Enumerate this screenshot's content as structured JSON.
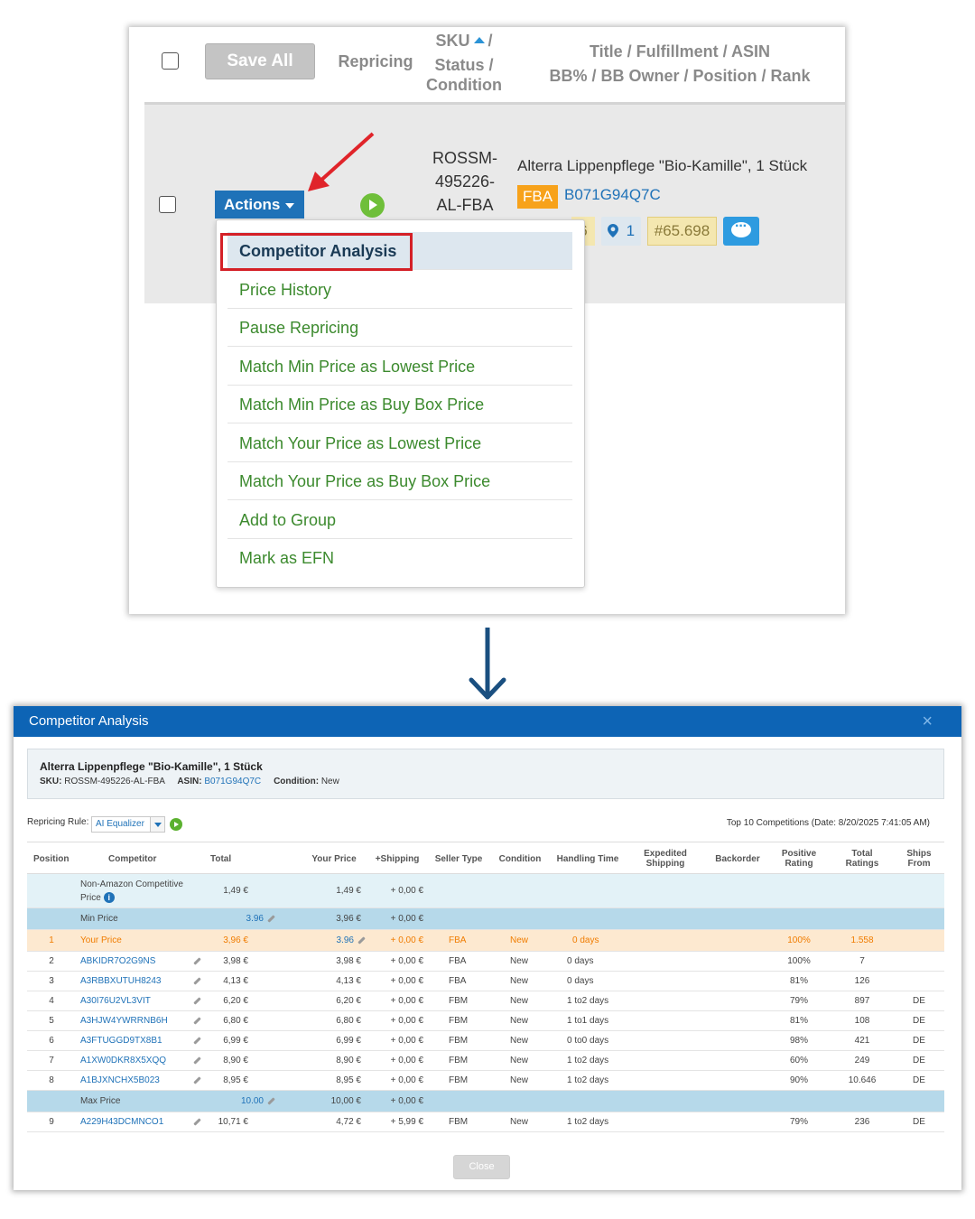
{
  "top_panel": {
    "header": {
      "save_all": "Save All",
      "repricing": "Repricing",
      "sku_line1": "SKU",
      "sku_slash": "/",
      "sku_line2": "Status /",
      "sku_line3": "Condition",
      "title_line1": "Title / Fulfillment / ASIN",
      "title_line2": "BB% / BB Owner / Position / Rank"
    },
    "row": {
      "actions_label": "Actions",
      "sku_lines": [
        "ROSSM-",
        "495226-",
        "AL-FBA"
      ],
      "title": "Alterra Lippenpflege \"Bio-Kamille\", 1 Stück",
      "fulfillment": "FBA",
      "asin": "B071G94Q7C",
      "bb_partial": "6",
      "position": "1",
      "rank": "#65.698"
    },
    "menu": {
      "items": [
        "Competitor Analysis",
        "Price History",
        "Pause Repricing",
        "Match Min Price as Lowest Price",
        "Match Min Price as Buy Box Price",
        "Match Your Price as Lowest Price",
        "Match Your Price as Buy Box Price",
        "Add to Group",
        "Mark as EFN"
      ]
    }
  },
  "modal": {
    "title": "Competitor Analysis",
    "close_x": "×",
    "product": {
      "title": "Alterra Lippenpflege \"Bio-Kamille\", 1 Stück",
      "sku_label": "SKU:",
      "sku": "ROSSM-495226-AL-FBA",
      "asin_label": "ASIN:",
      "asin": "B071G94Q7C",
      "condition_label": "Condition:",
      "condition": "New"
    },
    "repricing_rule_label": "Repricing Rule:",
    "repricing_rule_value": "AI Equalizer",
    "top_competitions": "Top 10 Competitions (Date: 8/20/2025 7:41:05 AM)",
    "columns": [
      "Position",
      "Competitor",
      "Total",
      "Your Price",
      "+Shipping",
      "Seller Type",
      "Condition",
      "Handling Time",
      "Expedited Shipping",
      "Backorder",
      "Positive Rating",
      "Total Ratings",
      "Ships From"
    ],
    "non_amazon": {
      "label_line1": "Non-Amazon Competitive",
      "label_line2": "Price",
      "total": "1,49 €",
      "your_price": "1,49 €",
      "shipping": "+ 0,00 €"
    },
    "min_price": {
      "label": "Min Price",
      "input": "3.96",
      "your_price": "3,96 €",
      "shipping": "+ 0,00 €"
    },
    "your_row": {
      "position": "1",
      "competitor": "Your Price",
      "total": "3,96 €",
      "your_price": "3.96",
      "shipping": "+ 0,00 €",
      "seller_type": "FBA",
      "condition": "New",
      "handling": "0 days",
      "positive": "100%",
      "ratings": "1.558"
    },
    "rows": [
      {
        "position": "2",
        "competitor": "ABKIDR7O2G9NS",
        "total": "3,98 €",
        "your_price": "3,98 €",
        "shipping": "+ 0,00 €",
        "seller_type": "FBA",
        "condition": "New",
        "handling": "0 days",
        "positive": "100%",
        "ratings": "7",
        "ships_from": ""
      },
      {
        "position": "3",
        "competitor": "A3RBBXUTUH8243",
        "total": "4,13 €",
        "your_price": "4,13 €",
        "shipping": "+ 0,00 €",
        "seller_type": "FBA",
        "condition": "New",
        "handling": "0 days",
        "positive": "81%",
        "ratings": "126",
        "ships_from": ""
      },
      {
        "position": "4",
        "competitor": "A30I76U2VL3VIT",
        "total": "6,20 €",
        "your_price": "6,20 €",
        "shipping": "+ 0,00 €",
        "seller_type": "FBM",
        "condition": "New",
        "handling": "1 to2 days",
        "positive": "79%",
        "ratings": "897",
        "ships_from": "DE"
      },
      {
        "position": "5",
        "competitor": "A3HJW4YWRRNB6H",
        "total": "6,80 €",
        "your_price": "6,80 €",
        "shipping": "+ 0,00 €",
        "seller_type": "FBM",
        "condition": "New",
        "handling": "1 to1 days",
        "positive": "81%",
        "ratings": "108",
        "ships_from": "DE"
      },
      {
        "position": "6",
        "competitor": "A3FTUGGD9TX8B1",
        "total": "6,99 €",
        "your_price": "6,99 €",
        "shipping": "+ 0,00 €",
        "seller_type": "FBM",
        "condition": "New",
        "handling": "0 to0 days",
        "positive": "98%",
        "ratings": "421",
        "ships_from": "DE"
      },
      {
        "position": "7",
        "competitor": "A1XW0DKR8X5XQQ",
        "total": "8,90 €",
        "your_price": "8,90 €",
        "shipping": "+ 0,00 €",
        "seller_type": "FBM",
        "condition": "New",
        "handling": "1 to2 days",
        "positive": "60%",
        "ratings": "249",
        "ships_from": "DE"
      },
      {
        "position": "8",
        "competitor": "A1BJXNCHX5B023",
        "total": "8,95 €",
        "your_price": "8,95 €",
        "shipping": "+ 0,00 €",
        "seller_type": "FBM",
        "condition": "New",
        "handling": "1 to2 days",
        "positive": "90%",
        "ratings": "10.646",
        "ships_from": "DE"
      }
    ],
    "max_price": {
      "label": "Max Price",
      "input": "10.00",
      "your_price": "10,00 €",
      "shipping": "+ 0,00 €"
    },
    "after_rows": [
      {
        "position": "9",
        "competitor": "A229H43DCMNCO1",
        "total": "10,71 €",
        "your_price": "4,72 €",
        "shipping": "+ 5,99 €",
        "seller_type": "FBM",
        "condition": "New",
        "handling": "1 to2 days",
        "positive": "79%",
        "ratings": "236",
        "ships_from": "DE"
      }
    ],
    "close_button": "Close"
  }
}
